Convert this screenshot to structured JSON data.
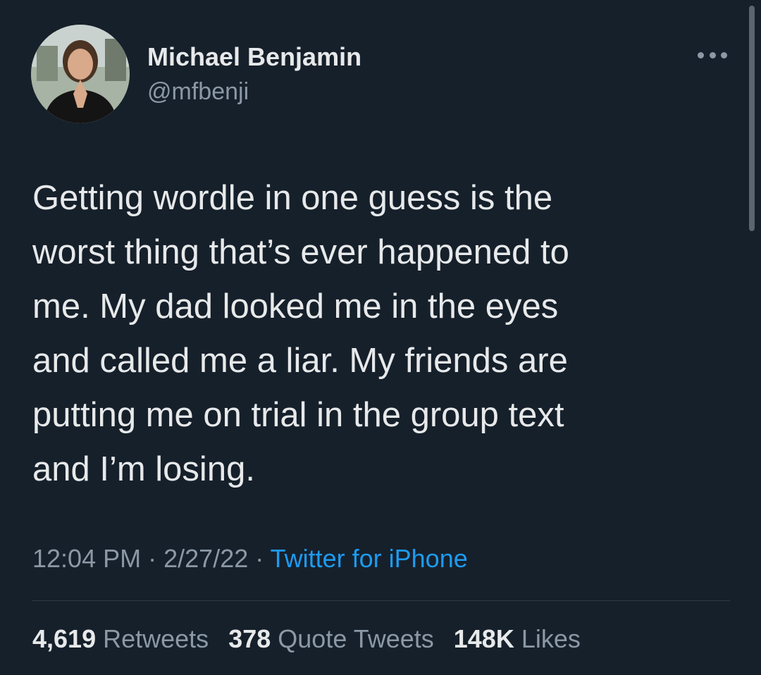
{
  "user": {
    "display_name": "Michael Benjamin",
    "handle": "@mfbenji"
  },
  "tweet": {
    "text": "Getting wordle in one guess is the\nworst thing that’s ever happened to\nme. My dad looked me in the eyes\nand called me a liar. My friends are\nputting me on trial in the group text\nand I’m losing.",
    "time": "12:04 PM",
    "date": "2/27/22",
    "separator": "·",
    "source": "Twitter for iPhone"
  },
  "stats": {
    "retweets_count": "4,619",
    "retweets_label": "Retweets",
    "quote_count": "378",
    "quote_label": "Quote Tweets",
    "likes_count": "148K",
    "likes_label": "Likes"
  },
  "icons": {
    "more": "more-horizontal-icon",
    "avatar": "profile-photo"
  },
  "colors": {
    "background": "#16202b",
    "text": "#e7e9ea",
    "secondary": "#8b98a5",
    "accent": "#1d9bf0"
  }
}
